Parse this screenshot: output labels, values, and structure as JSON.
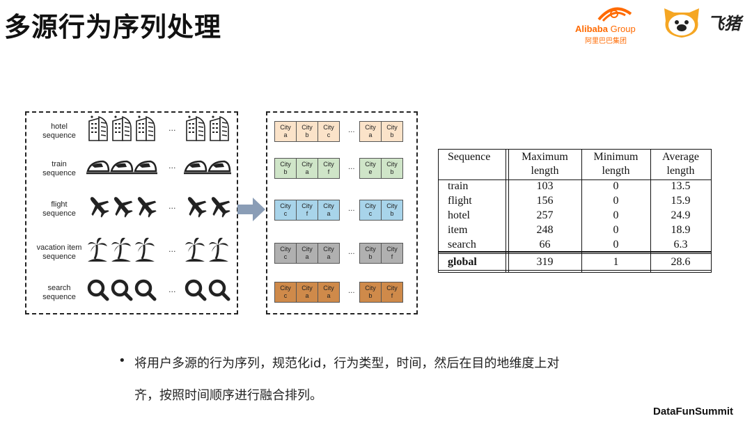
{
  "title": "多源行为序列处理",
  "logos": {
    "alibaba_name": "Alibaba",
    "alibaba_group": "Group",
    "alibaba_cn": "阿里巴巴集团",
    "fliggy": "飞猪",
    "alibaba_color": "#ff6a00",
    "pig_color": "#f5a623"
  },
  "sequences": [
    {
      "label_line1": "hotel",
      "label_line2": "sequence",
      "icon": "hotel-building-icon"
    },
    {
      "label_line1": "train",
      "label_line2": "sequence",
      "icon": "train-icon"
    },
    {
      "label_line1": "flight",
      "label_line2": "sequence",
      "icon": "airplane-icon"
    },
    {
      "label_line1": "vacation item",
      "label_line2": "sequence",
      "icon": "palm-tree-icon"
    },
    {
      "label_line1": "search",
      "label_line2": "sequence",
      "icon": "magnifier-icon"
    }
  ],
  "ellipsis": "...",
  "aligned_rows": [
    {
      "color": "#fbe3c9",
      "group1": [
        [
          "City",
          "a"
        ],
        [
          "City",
          "b"
        ],
        [
          "City",
          "c"
        ]
      ],
      "group2": [
        [
          "City",
          "a"
        ],
        [
          "City",
          "b"
        ]
      ]
    },
    {
      "color": "#cfe5c8",
      "group1": [
        [
          "City",
          "b"
        ],
        [
          "City",
          "a"
        ],
        [
          "City",
          "f"
        ]
      ],
      "group2": [
        [
          "City",
          "e"
        ],
        [
          "City",
          "b"
        ]
      ]
    },
    {
      "color": "#a8d4ea",
      "group1": [
        [
          "City",
          "c"
        ],
        [
          "City",
          "f"
        ],
        [
          "City",
          "a"
        ]
      ],
      "group2": [
        [
          "City",
          "c"
        ],
        [
          "City",
          "b"
        ]
      ]
    },
    {
      "color": "#b0b0b0",
      "group1": [
        [
          "City",
          "c"
        ],
        [
          "City",
          "a"
        ],
        [
          "City",
          "a"
        ]
      ],
      "group2": [
        [
          "City",
          "b"
        ],
        [
          "City",
          "f"
        ]
      ]
    },
    {
      "color": "#cf8a4a",
      "group1": [
        [
          "City",
          "c"
        ],
        [
          "City",
          "a"
        ],
        [
          "City",
          "a"
        ]
      ],
      "group2": [
        [
          "City",
          "b"
        ],
        [
          "City",
          "f"
        ]
      ]
    }
  ],
  "table": {
    "headers": [
      [
        "Sequence",
        ""
      ],
      [
        "Maximum",
        "length"
      ],
      [
        "Minimum",
        "length"
      ],
      [
        "Average",
        "length"
      ]
    ],
    "rows": [
      [
        "train",
        "103",
        "0",
        "13.5"
      ],
      [
        "flight",
        "156",
        "0",
        "15.9"
      ],
      [
        "hotel",
        "257",
        "0",
        "24.9"
      ],
      [
        "item",
        "248",
        "0",
        "18.9"
      ],
      [
        "search",
        "66",
        "0",
        "6.3"
      ]
    ],
    "global": [
      "global",
      "319",
      "1",
      "28.6"
    ]
  },
  "bullet": "•",
  "body_line1": "将用户多源的行为序列，规范化id，行为类型，时间，然后在目的地维度上对",
  "body_line2": "齐，按照时间顺序进行融合排列。",
  "footer": "DataFunSummit"
}
